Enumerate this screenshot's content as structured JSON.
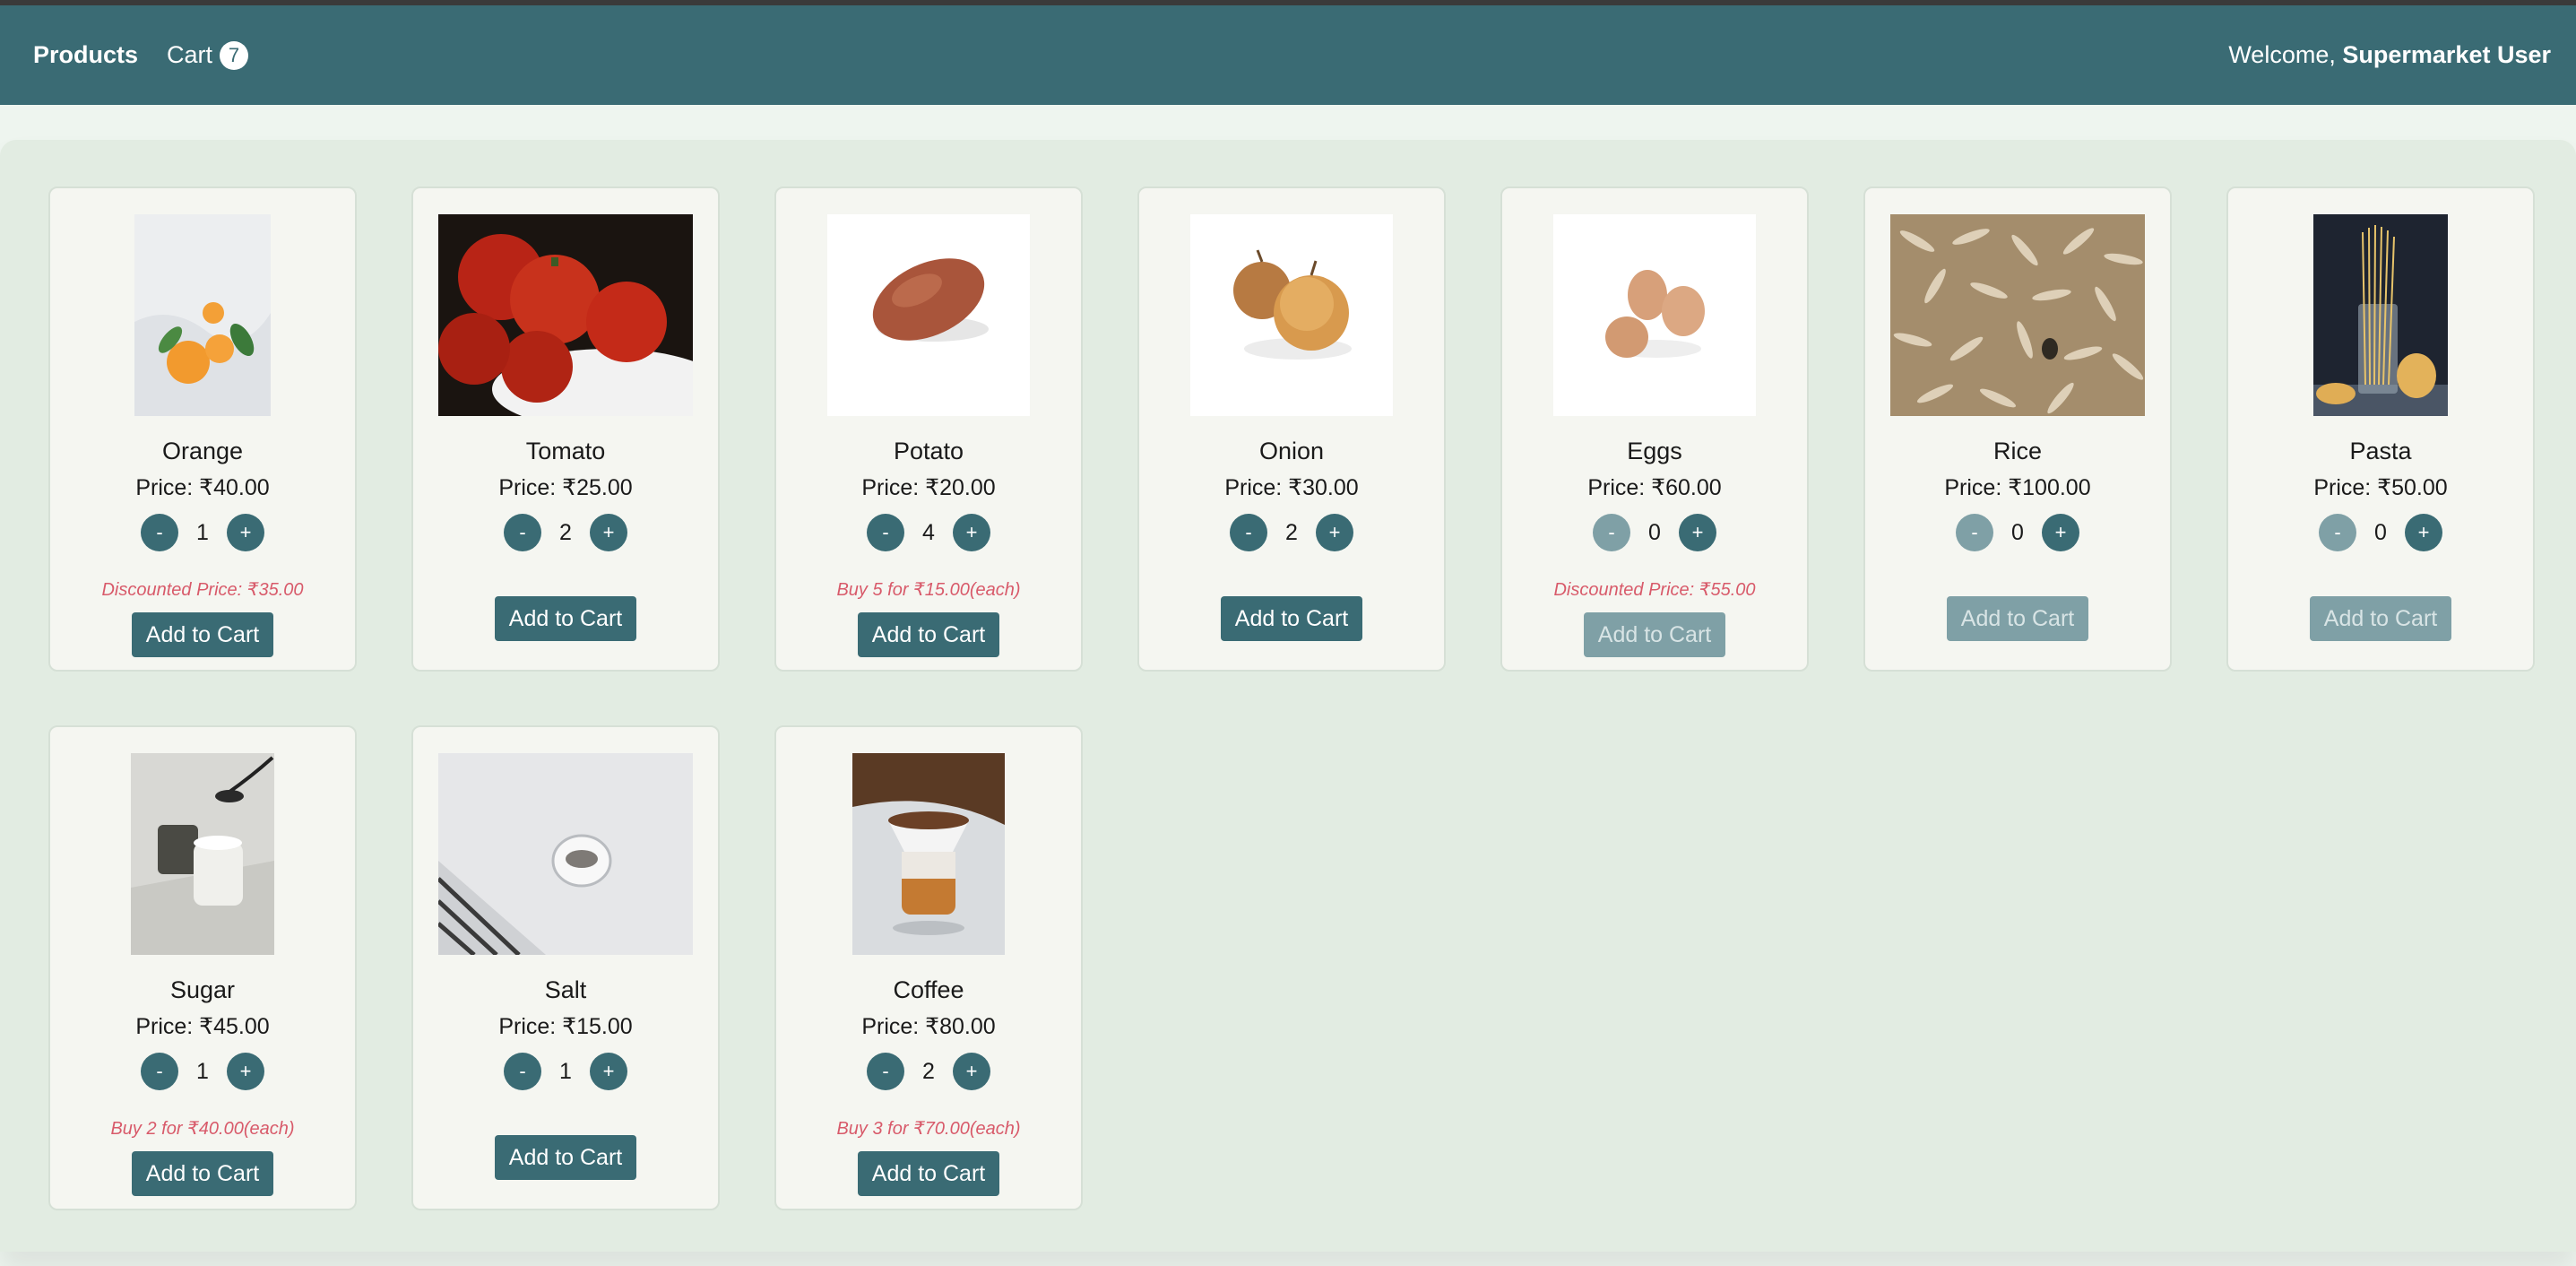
{
  "nav": {
    "brand": "Products",
    "cart_label": "Cart",
    "cart_count": "7",
    "welcome_prefix": "Welcome,",
    "user_name": "Supermarket User"
  },
  "products": [
    {
      "name": "Orange",
      "price": "Price: ₹40.00",
      "qty": "1",
      "promo": "Discounted Price: ₹35.00",
      "add": "Add to Cart",
      "icon": "orange-image"
    },
    {
      "name": "Tomato",
      "price": "Price: ₹25.00",
      "qty": "2",
      "promo": "",
      "add": "Add to Cart",
      "icon": "tomato-image"
    },
    {
      "name": "Potato",
      "price": "Price: ₹20.00",
      "qty": "4",
      "promo": "Buy 5 for ₹15.00(each)",
      "add": "Add to Cart",
      "icon": "potato-image"
    },
    {
      "name": "Onion",
      "price": "Price: ₹30.00",
      "qty": "2",
      "promo": "",
      "add": "Add to Cart",
      "icon": "onion-image"
    },
    {
      "name": "Eggs",
      "price": "Price: ₹60.00",
      "qty": "0",
      "promo": "Discounted Price: ₹55.00",
      "add": "Add to Cart",
      "icon": "eggs-image"
    },
    {
      "name": "Rice",
      "price": "Price: ₹100.00",
      "qty": "0",
      "promo": "",
      "add": "Add to Cart",
      "icon": "rice-image"
    },
    {
      "name": "Pasta",
      "price": "Price: ₹50.00",
      "qty": "0",
      "promo": "",
      "add": "Add to Cart",
      "icon": "pasta-image"
    },
    {
      "name": "Sugar",
      "price": "Price: ₹45.00",
      "qty": "1",
      "promo": "Buy 2 for ₹40.00(each)",
      "add": "Add to Cart",
      "icon": "sugar-image"
    },
    {
      "name": "Salt",
      "price": "Price: ₹15.00",
      "qty": "1",
      "promo": "",
      "add": "Add to Cart",
      "icon": "salt-image"
    },
    {
      "name": "Coffee",
      "price": "Price: ₹80.00",
      "qty": "2",
      "promo": "Buy 3 for ₹70.00(each)",
      "add": "Add to Cart",
      "icon": "coffee-image"
    }
  ],
  "controls": {
    "minus": "-",
    "plus": "+"
  },
  "colors": {
    "primary": "#3a6b74",
    "promo": "#d85a6a",
    "disabled": "#7fa0a6"
  }
}
